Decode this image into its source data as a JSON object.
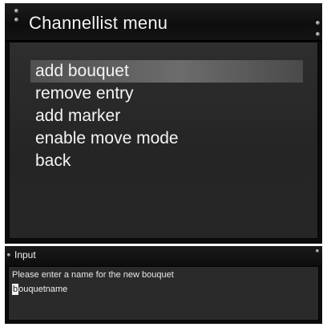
{
  "menu": {
    "title": "Channellist menu",
    "items": [
      {
        "label": "add bouquet",
        "selected": true
      },
      {
        "label": "remove entry",
        "selected": false
      },
      {
        "label": "add marker",
        "selected": false
      },
      {
        "label": "enable move mode",
        "selected": false
      },
      {
        "label": "back",
        "selected": false
      }
    ]
  },
  "input": {
    "title": "Input",
    "prompt": "Please enter a name for the new bouquet",
    "value_cursor_char": "b",
    "value_rest": "ouquetname"
  },
  "colors": {
    "window_bg": "#0b0b0b",
    "body_bg": "#2a2a2a",
    "selection": "#6c6c6c",
    "text": "#f2f2f2"
  }
}
